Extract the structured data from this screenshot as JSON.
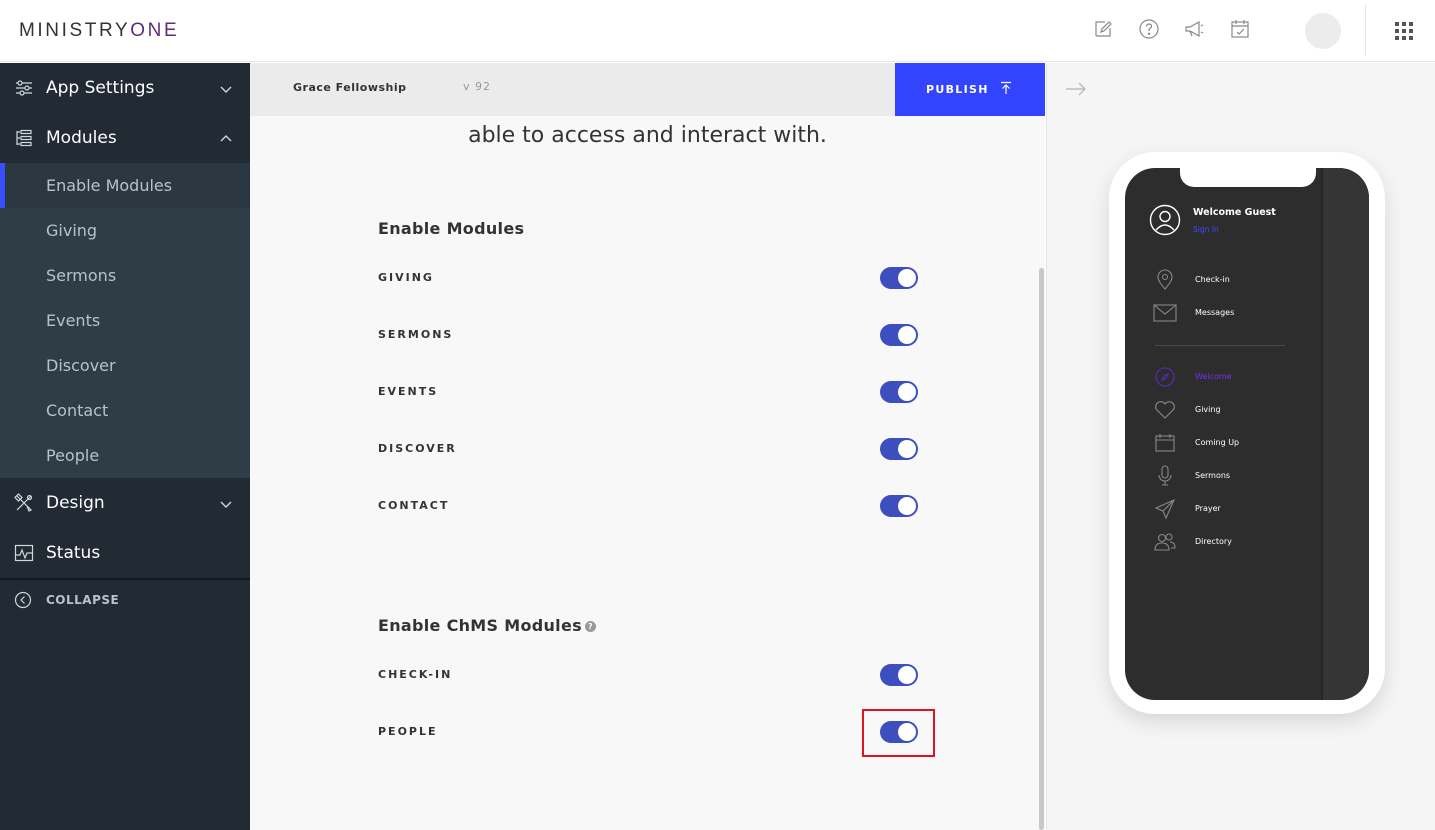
{
  "topbar": {
    "logo_part1": "MINISTRY",
    "logo_part2": "ONE",
    "icons": [
      "edit-icon",
      "help-icon",
      "megaphone-icon",
      "calendar-check-icon",
      "avatar",
      "apps-grid-icon"
    ]
  },
  "sidebar": {
    "items": [
      {
        "label": "App Settings",
        "icon": "sliders-icon",
        "expanded": false
      },
      {
        "label": "Modules",
        "icon": "list-icon",
        "expanded": true
      },
      {
        "label": "Design",
        "icon": "tools-icon",
        "expanded": false
      },
      {
        "label": "Status",
        "icon": "pulse-icon"
      }
    ],
    "submenu": [
      "Enable Modules",
      "Giving",
      "Sermons",
      "Events",
      "Discover",
      "Contact",
      "People"
    ],
    "active_submenu": "Enable Modules",
    "collapse_label": "COLLAPSE"
  },
  "header": {
    "org_name": "Grace Fellowship",
    "version": "v 92",
    "publish_label": "PUBLISH"
  },
  "main": {
    "intro_text": "able to access and interact with.",
    "modules_title": "Enable Modules",
    "modules": [
      {
        "label": "GIVING",
        "enabled": true
      },
      {
        "label": "SERMONS",
        "enabled": true
      },
      {
        "label": "EVENTS",
        "enabled": true
      },
      {
        "label": "DISCOVER",
        "enabled": true
      },
      {
        "label": "CONTACT",
        "enabled": true
      }
    ],
    "chms_title": "Enable ChMS Modules",
    "chms_help": "?",
    "chms_modules": [
      {
        "label": "CHECK-IN",
        "enabled": true
      },
      {
        "label": "PEOPLE",
        "enabled": true
      }
    ]
  },
  "preview": {
    "welcome": "Welcome Guest",
    "sign_in": "Sign In",
    "menu_top": [
      {
        "label": "Check-in",
        "icon": "location-pin-icon"
      },
      {
        "label": "Messages",
        "icon": "envelope-icon"
      }
    ],
    "menu": [
      {
        "label": "Welcome",
        "icon": "compass-icon",
        "active": true
      },
      {
        "label": "Giving",
        "icon": "heart-icon"
      },
      {
        "label": "Coming Up",
        "icon": "calendar-icon"
      },
      {
        "label": "Sermons",
        "icon": "microphone-icon"
      },
      {
        "label": "Prayer",
        "icon": "paper-plane-icon"
      },
      {
        "label": "Directory",
        "icon": "people-icon"
      }
    ]
  },
  "colors": {
    "accent": "#3344ff",
    "toggle_on": "#3d4fbf",
    "sidebar_bg": "#222b33",
    "submenu_bg": "#2f3d47",
    "active_menu": "#7b2ff7",
    "highlight": "#e0141e"
  }
}
